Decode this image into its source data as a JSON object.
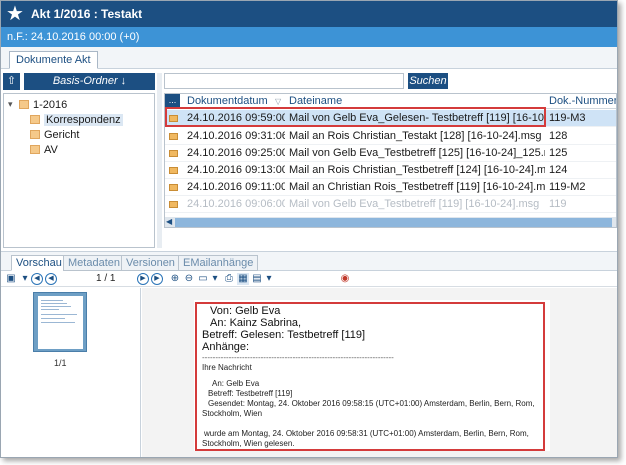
{
  "window": {
    "title": "Akt 1/2016 : Testakt",
    "subtitle": "n.F.: 24.10.2016 00:00 (+0)"
  },
  "tabs": {
    "documents": "Dokumente Akt"
  },
  "left": {
    "basis_button": "Basis-Ordner ↓",
    "tree": [
      {
        "label": "1-2016",
        "level": 0
      },
      {
        "label": "Korrespondenz",
        "level": 1,
        "selected": true
      },
      {
        "label": "Gericht",
        "level": 1
      },
      {
        "label": "AV",
        "level": 1
      }
    ]
  },
  "search": {
    "placeholder": "",
    "button": "Suchen"
  },
  "grid": {
    "corner": "...",
    "columns": {
      "date": "Dokumentdatum",
      "name": "Dateiname",
      "number": "Dok.-Nummer",
      "sort_indicator": "▽"
    },
    "rows": [
      {
        "date": "24.10.2016 09:59:00",
        "name": "Mail von Gelb Eva_Gelesen- Testbetreff [119] [16-10-24...",
        "number": "119-M3"
      },
      {
        "date": "24.10.2016 09:31:06",
        "name": "Mail an Rois Christian_Testakt [128] [16-10-24].msg",
        "number": "128"
      },
      {
        "date": "24.10.2016 09:25:00",
        "name": "Mail von Gelb Eva_Testbetreff [125] [16-10-24]_125.msg",
        "number": "125"
      },
      {
        "date": "24.10.2016 09:13:00",
        "name": "Mail an Rois Christian_Testbetreff [124] [16-10-24].msg",
        "number": "124"
      },
      {
        "date": "24.10.2016 09:11:00",
        "name": "Mail an Christian Rois_Testbetreff [119] [16-10-24].msg",
        "number": "119-M2"
      },
      {
        "date": "24.10.2016 09:06:00",
        "name": "Mail von Gelb Eva_Testbetreff [119] [16-10-24].msg",
        "number": "119"
      }
    ]
  },
  "preview_tabs": {
    "preview": "Vorschau",
    "metadata": "Metadaten",
    "versions": "Versionen",
    "attachments": "EMailanhänge"
  },
  "preview": {
    "page_counter": "1 / 1",
    "thumb_label": "1/1",
    "mail": {
      "from": "Von: Gelb Eva",
      "to": "An: Kainz Sabrina,",
      "subject": "Betreff: Gelesen: Testbetreff [119]",
      "attachments": "Anhänge:",
      "separator": "------------------------------------------------------------------------",
      "body_title": "Ihre Nachricht",
      "b_to": "An: Gelb Eva",
      "b_subject": "Betreff: Testbetreff [119]",
      "b_sent": "Gesendet: Montag, 24. Oktober 2016 09:58:15 (UTC+01:00) Amsterdam, Berlin, Bern, Rom,",
      "b_sent2": "Stockholm, Wien",
      "b_read": "wurde am Montag, 24. Oktober 2016 09:58:31 (UTC+01:00) Amsterdam, Berlin, Bern, Rom,",
      "b_read2": "Stockholm, Wien gelesen."
    }
  },
  "colors": {
    "titlebar": "#1c4f82",
    "subbar": "#3d93d6",
    "highlight": "#d43b3b",
    "selected_row": "#cfe3f6"
  }
}
